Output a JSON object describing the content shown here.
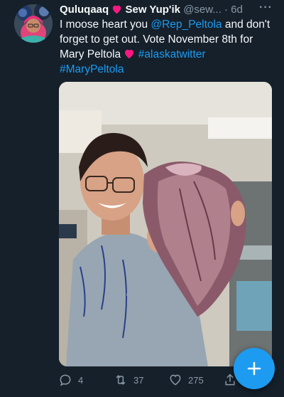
{
  "header": {
    "display_name": "Quluqaaq",
    "heart": "❤️",
    "name_rest": "Sew Yup'ik",
    "handle": "@sew...",
    "separator": "·",
    "time": "6d",
    "more_label": "···"
  },
  "tweet": {
    "text_1": "I moose heart you ",
    "mention": "@Rep_Peltola",
    "text_2": " and don't forget to get out. Vote November 8th for Mary Peltola ",
    "heart": "❤️",
    "hashtag_1": "#alaskatwitter",
    "hashtag_2": "#MaryPeltola"
  },
  "actions": {
    "replies": "4",
    "retweets": "37",
    "likes": "275"
  },
  "colors": {
    "background": "#15202b",
    "link": "#1d9bf0",
    "secondary_text": "#8b98a5",
    "heart": "#f91880"
  },
  "icons": {
    "reply": "reply-icon",
    "retweet": "retweet-icon",
    "like": "like-icon",
    "share": "share-icon",
    "compose": "plus-icon"
  }
}
